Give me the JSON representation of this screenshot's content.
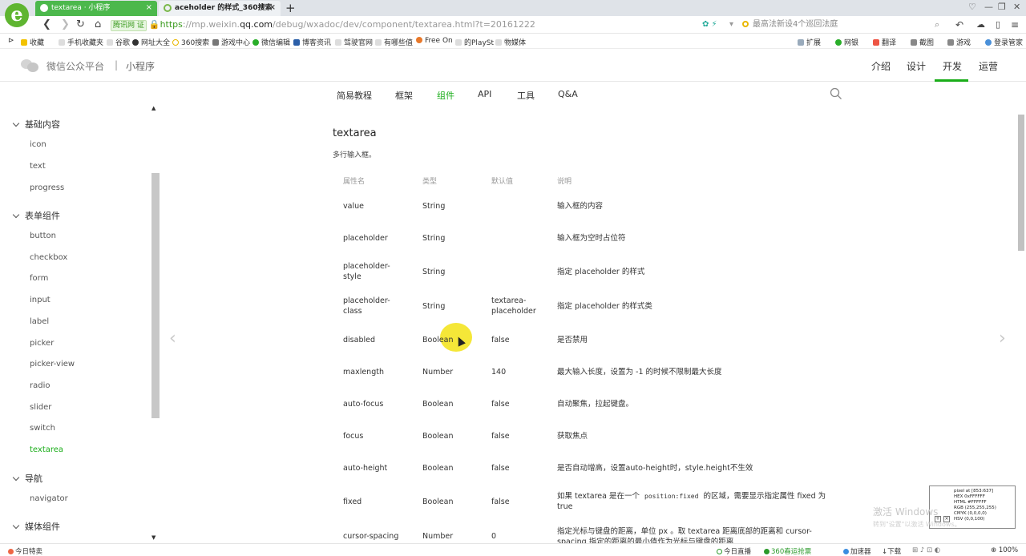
{
  "browser": {
    "tabs": [
      {
        "label": "textarea · 小程序",
        "close": "×"
      },
      {
        "label": "aceholder 的样式_360搜索",
        "close": "×"
      }
    ],
    "new_tab": "+",
    "address": {
      "site_badge": "腾讯网 证",
      "scheme": "https",
      "prefix": "://mp.weixin.",
      "host": "qq.com",
      "path": "/debug/wxadoc/dev/component/textarea.html?t=20161222"
    },
    "search_placeholder": "最高法新设4个巡回法庭",
    "bookmarks": [
      "收藏",
      "手机收藏夹",
      "谷歌",
      "网址大全",
      "360搜索",
      "游戏中心",
      "微信编辑",
      "博客资讯",
      "驾驶官网",
      "有哪些值",
      "Free On",
      "的PlaySt",
      "物媒体"
    ],
    "right_tools": [
      "扩展",
      "网银",
      "翻译",
      "截图",
      "游戏",
      "登录管家"
    ],
    "window_controls": [
      "♡",
      "—",
      "❐",
      "✕"
    ]
  },
  "header": {
    "site_name": "微信公众平台",
    "separator": "|",
    "site_sub": "小程序",
    "nav": [
      "介绍",
      "设计",
      "开发",
      "运营"
    ]
  },
  "subnav": [
    "简易教程",
    "框架",
    "组件",
    "API",
    "工具",
    "Q&A"
  ],
  "sidebar": {
    "categories": [
      {
        "label": "基础内容",
        "items": [
          "icon",
          "text",
          "progress"
        ]
      },
      {
        "label": "表单组件",
        "items": [
          "button",
          "checkbox",
          "form",
          "input",
          "label",
          "picker",
          "picker-view",
          "radio",
          "slider",
          "switch",
          "textarea"
        ]
      },
      {
        "label": "导航",
        "items": [
          "navigator"
        ]
      },
      {
        "label": "媒体组件",
        "items": []
      }
    ],
    "active_item": "textarea"
  },
  "main": {
    "title": "textarea",
    "description": "多行输入框。",
    "columns": [
      "属性名",
      "类型",
      "默认值",
      "说明"
    ],
    "rows": [
      {
        "name": "value",
        "type": "String",
        "default": "",
        "desc": "输入框的内容"
      },
      {
        "name": "placeholder",
        "type": "String",
        "default": "",
        "desc": "输入框为空时占位符"
      },
      {
        "name": "placeholder-style",
        "type": "String",
        "default": "",
        "desc": "指定 placeholder 的样式"
      },
      {
        "name": "placeholder-class",
        "type": "String",
        "default": "textarea-placeholder",
        "desc": "指定 placeholder 的样式类"
      },
      {
        "name": "disabled",
        "type": "Boolean",
        "default": "false",
        "desc": "是否禁用"
      },
      {
        "name": "maxlength",
        "type": "Number",
        "default": "140",
        "desc": "最大输入长度，设置为 -1 的时候不限制最大长度"
      },
      {
        "name": "auto-focus",
        "type": "Boolean",
        "default": "false",
        "desc": "自动聚焦，拉起键盘。"
      },
      {
        "name": "focus",
        "type": "Boolean",
        "default": "false",
        "desc": "获取焦点"
      },
      {
        "name": "auto-height",
        "type": "Boolean",
        "default": "false",
        "desc": "是否自动增高，设置auto-height时，style.height不生效"
      },
      {
        "name": "fixed",
        "type": "Boolean",
        "default": "false",
        "desc_pre": "如果 textarea 是在一个 ",
        "desc_code": "position:fixed",
        "desc_post": " 的区域，需要显示指定属性 fixed 为 true"
      },
      {
        "name": "cursor-spacing",
        "type": "Number",
        "default": "0",
        "desc": "指定光标与键盘的距离，单位 px 。取 textarea 距离底部的距离和 cursor-spacing 指定的距离的最小值作为光标与键盘的距离"
      }
    ]
  },
  "pixel_info": [
    "pixel at [853:637]",
    "HEX 0xFFFFFF",
    "HTML #FFFFFF",
    "RGB (255,255,255)",
    "CMYK (0,0,0,0)",
    "HSV (0,0,100)"
  ],
  "watermark": {
    "line1": "激活 Windows",
    "line2": "转到\"设置\"以激活 Windows。"
  },
  "statusbar": {
    "left": "今日特卖",
    "items": [
      "今日直播",
      "360春运抢票",
      "加速器",
      "下载"
    ],
    "zoom": "100%"
  },
  "colors": {
    "accent": "#1aad19",
    "tab_active": "#4cb84c",
    "highlight": "#f4e62d"
  }
}
